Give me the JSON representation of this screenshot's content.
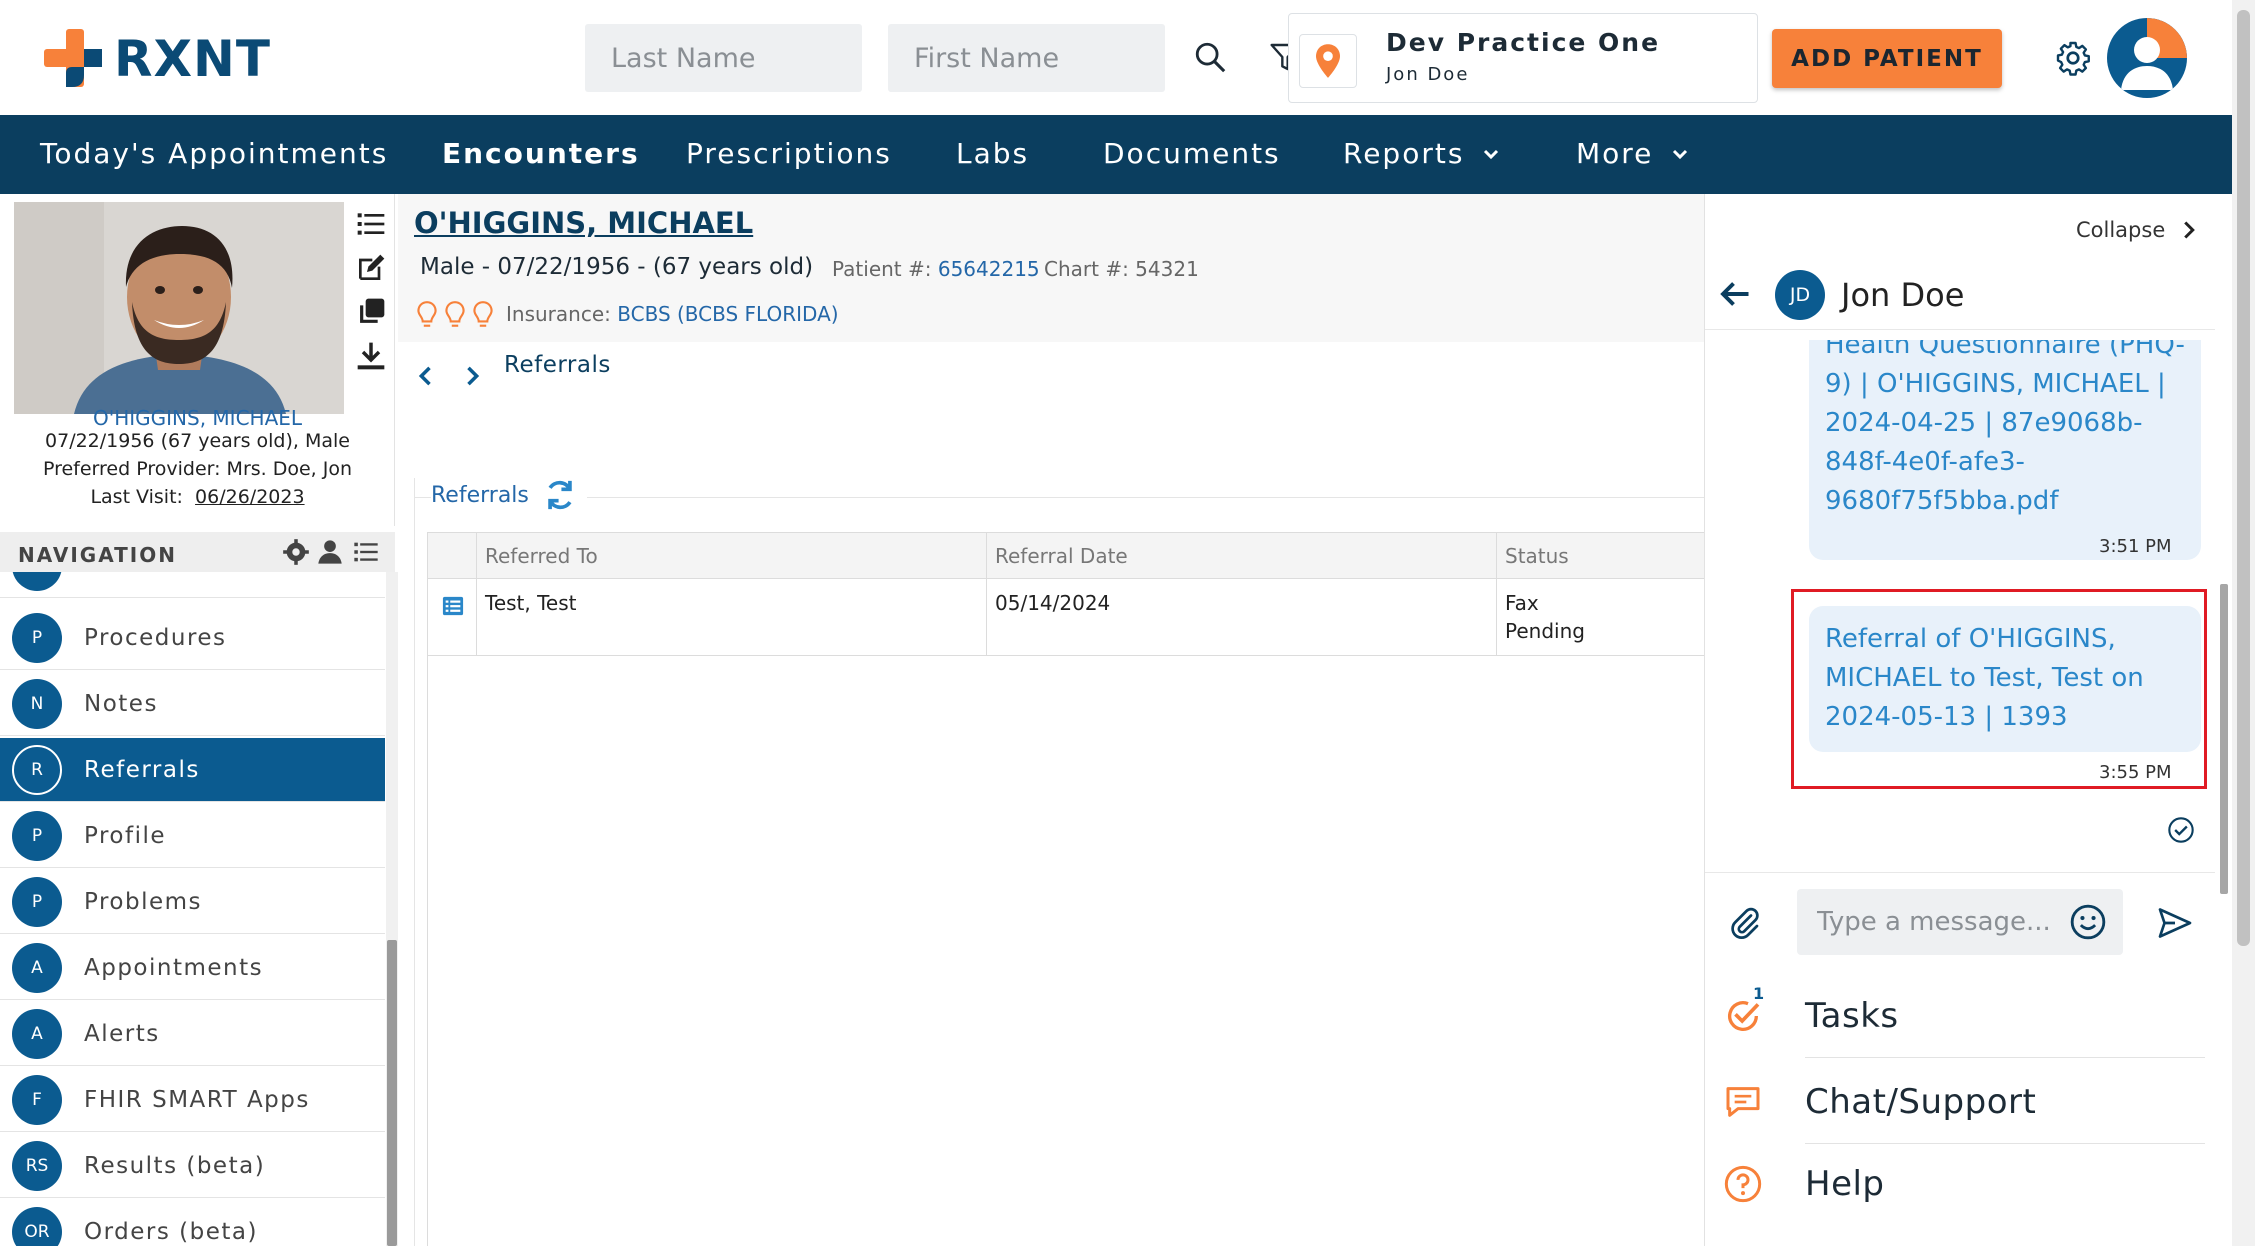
{
  "header": {
    "logo_text": "RXNT",
    "last_name_placeholder": "Last Name",
    "first_name_placeholder": "First Name",
    "practice_name": "Dev Practice One",
    "practice_user": "Jon Doe",
    "add_patient_label": "ADD PATIENT"
  },
  "nav": {
    "items": [
      {
        "label": "Today's Appointments"
      },
      {
        "label": "Encounters",
        "active": true
      },
      {
        "label": "Prescriptions"
      },
      {
        "label": "Labs"
      },
      {
        "label": "Documents"
      },
      {
        "label": "Reports",
        "has_dropdown": true
      },
      {
        "label": "More",
        "has_dropdown": true
      }
    ]
  },
  "patient_card": {
    "name": "O'HIGGINS, MICHAEL",
    "dob_line": "07/22/1956 (67 years old), Male",
    "provider_line": "Preferred Provider: Mrs. Doe, Jon",
    "last_visit_label": "Last Visit:",
    "last_visit_date": "06/26/2023"
  },
  "navigation": {
    "title": "NAVIGATION",
    "items": [
      {
        "initial": "P",
        "label": "Procedures"
      },
      {
        "initial": "N",
        "label": "Notes"
      },
      {
        "initial": "R",
        "label": "Referrals",
        "selected": true
      },
      {
        "initial": "P",
        "label": "Profile"
      },
      {
        "initial": "P",
        "label": "Problems"
      },
      {
        "initial": "A",
        "label": "Appointments"
      },
      {
        "initial": "A",
        "label": "Alerts"
      },
      {
        "initial": "F",
        "label": "FHIR SMART Apps"
      },
      {
        "initial": "RS",
        "label": "Results (beta)"
      },
      {
        "initial": "OR",
        "label": "Orders (beta)"
      }
    ]
  },
  "main": {
    "patient_title": "O'HIGGINS, MICHAEL",
    "patient_sub": "Male - 07/22/1956 - (67 years old)",
    "patient_num_label": "Patient #:",
    "patient_num": "65642215",
    "chart_num": "Chart #: 54321",
    "insurance_label": "Insurance:",
    "insurance_value": "BCBS (BCBS FLORIDA)",
    "breadcrumb": "Referrals",
    "panel_title": "Referrals",
    "table": {
      "columns": [
        "Referred To",
        "Referral Date",
        "Status"
      ],
      "rows": [
        {
          "referred_to": "Test, Test",
          "referral_date": "05/14/2024",
          "status_line1": "Fax",
          "status_line2": "Pending"
        }
      ]
    }
  },
  "chat": {
    "collapse_label": "Collapse",
    "contact_initials": "JD",
    "contact_name": "Jon Doe",
    "messages": [
      {
        "lines": [
          "Health Questionnaire (PHQ-",
          "9) | O'HIGGINS, MICHAEL |",
          "2024-04-25 | 87e9068b-",
          "848f-4e0f-afe3-",
          "9680f75f5bba.pdf"
        ],
        "time": "3:51 PM"
      },
      {
        "lines": [
          "Referral of O'HIGGINS,",
          "MICHAEL to Test, Test on",
          "2024-05-13 | 1393"
        ],
        "time": "3:55 PM"
      }
    ],
    "message_placeholder": "Type a message...",
    "tasks_label": "Tasks",
    "tasks_badge": "1",
    "chat_support_label": "Chat/Support",
    "help_label": "Help"
  },
  "colors": {
    "navbar": "#0b3e5f",
    "accent_orange": "#f7813a",
    "primary_blue": "#0b5b90",
    "highlight_red": "#e01b24"
  }
}
